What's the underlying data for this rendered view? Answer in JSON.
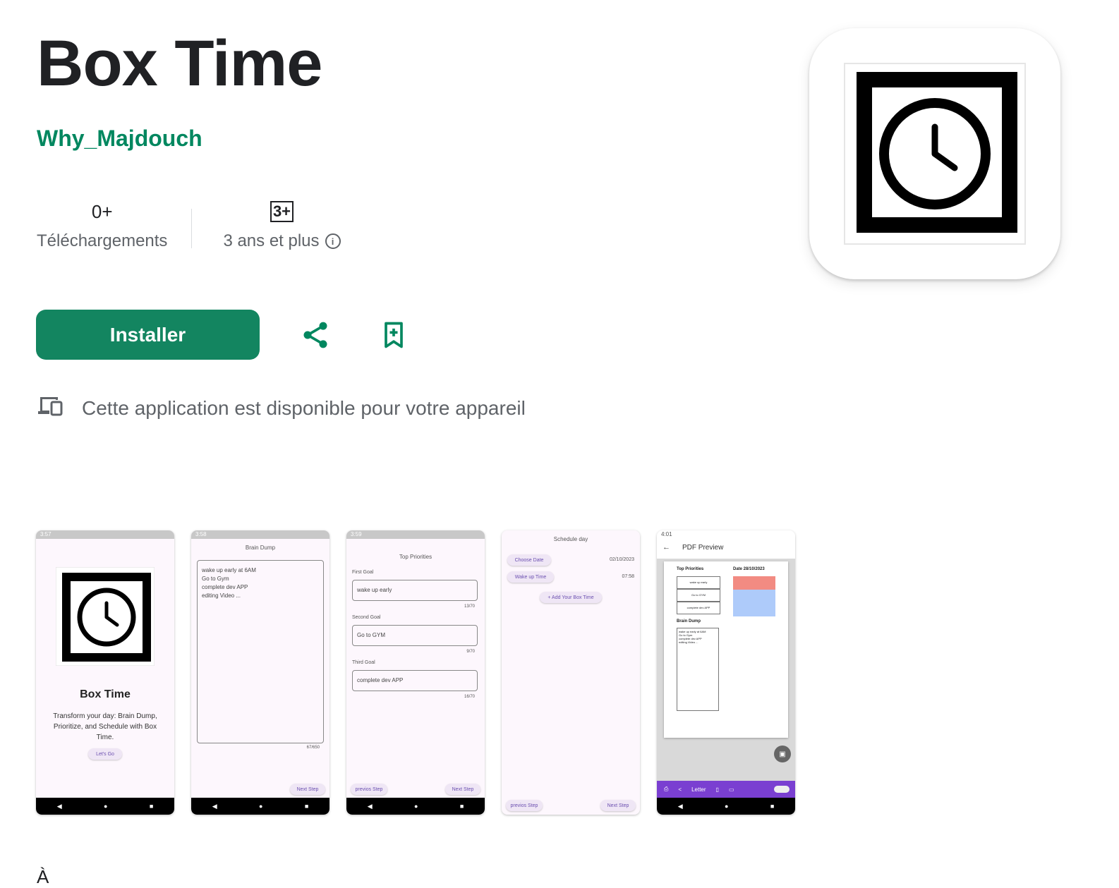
{
  "app": {
    "title": "Box Time",
    "developer": "Why_Majdouch",
    "downloads_value": "0+",
    "downloads_label": "Téléchargements",
    "rating_badge": "3+",
    "rating_label": "3 ans et plus",
    "install_label": "Installer",
    "availability_text": "Cette application est disponible pour votre appareil",
    "brand_color": "#01875f",
    "bottom_char": "À"
  },
  "icons": [
    "info-icon",
    "share-icon",
    "bookmark-add-icon",
    "devices-icon",
    "clock-icon"
  ],
  "screenshots": {
    "s1": {
      "status_time": "3:57",
      "title": "Box Time",
      "desc": "Transform your day: Brain Dump, Prioritize, and Schedule with Box Time.",
      "button": "Let's Go"
    },
    "s2": {
      "status_time": "3:58",
      "header": "Brain Dump",
      "lines": [
        "wake up early at 6AM",
        "Go to Gym",
        "complete dev APP",
        "editing Video ..."
      ],
      "counter": "67/650",
      "next": "Next Step"
    },
    "s3": {
      "status_time": "3:59",
      "header": "Top Priorities",
      "first_label": "First Goal",
      "first_value": "wake up early",
      "first_count": "13/70",
      "second_label": "Second Goal",
      "second_value": "Go to GYM",
      "second_count": "9/70",
      "third_label": "Third Goal",
      "third_value": "complete dev APP",
      "third_count": "16/70",
      "prev": "previos Step",
      "next": "Next Step"
    },
    "s4": {
      "header": "Schedule day",
      "choose_date": "Choose Date",
      "date_value": "02/10/2023",
      "wake_up": "Wake up Time",
      "time_value": "07:58",
      "add_box": "+ Add Your Box Time",
      "prev": "previos Step",
      "next": "Next Step"
    },
    "s5": {
      "status_time": "4:01",
      "header": "PDF Preview",
      "top_priorities": "Top Priorities",
      "date_label": "Date 28/10/2023",
      "priorities": [
        "wake up early",
        "Go to GYM",
        "complete dev APP"
      ],
      "brain_dump": "Brain Dump",
      "dump_lines": [
        "wake up early at 6AM",
        "Go to Gym",
        "complete dev APP",
        "editing Video ..."
      ],
      "paper": "Letter"
    }
  }
}
